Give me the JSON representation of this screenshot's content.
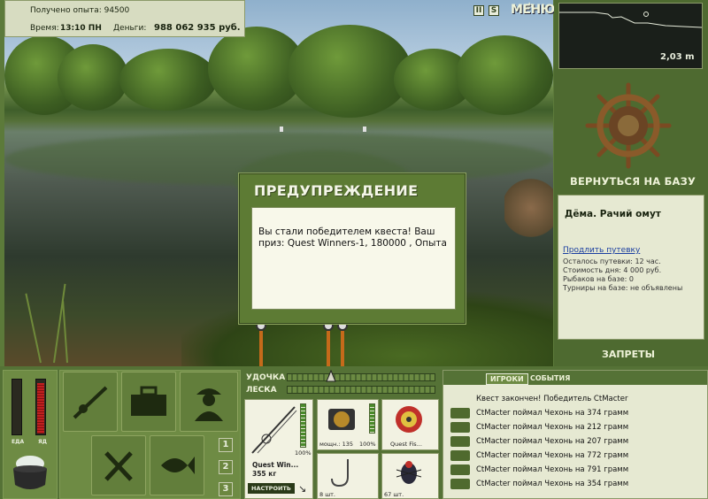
{
  "hud": {
    "exp_label": "Получено опыта: 94500",
    "time_label": "Время:",
    "time_value": "13:10 ПН",
    "money_label": "Деньги:",
    "money_value": "988 062 935 руб."
  },
  "toolbar": {
    "pause_icon": "II",
    "sound_icon": "S",
    "menu_label": "МЕНЮ"
  },
  "depth": {
    "value": "2,03 m"
  },
  "base": {
    "back_label": "ВЕРНУТЬСЯ НА БАЗУ",
    "location": "Дёма. Рачий омут",
    "extend_link": "Продлить путевку",
    "lines": [
      "Осталось путевки: 12 час.",
      "Стоимость дня: 4 000 руб.",
      "Рыбаков на базе: 0",
      "Турниры на базе: не объявлены"
    ],
    "bans_label": "ЗАПРЕТЫ"
  },
  "dialog": {
    "title": "ПРЕДУПРЕЖДЕНИЕ",
    "message": "Вы стали победителем квеста! Ваш приз: Quest Winners-1, 180000 , Опыта"
  },
  "status": {
    "food_label": "ЕДА",
    "poison_label": "ЯД",
    "food_level": 0.0,
    "poison_level": 0.92
  },
  "pages": [
    "1",
    "2",
    "3"
  ],
  "tackle": {
    "rod_label": "УДОЧКА",
    "line_label": "ЛЕСКА",
    "rod_name": "Quest Win...",
    "rod_weight": "355 кг",
    "rod_percent": "100%",
    "setup_button": "НАСТРОИТЬ",
    "reel_power": "мощн.: 135",
    "reel_percent": "100%",
    "line_name": "Quest Fis...",
    "hooks_count": "8 шт.",
    "bait_count": "67 шт."
  },
  "log": {
    "tab_players": "ИГРОКИ",
    "tab_events": "СОБЫТИЯ",
    "header": "Квест закончен! Победитель CtMacter",
    "entries": [
      "CtMacter поймал Чехонь на 374 грамм",
      "CtMacter поймал Чехонь на 212 грамм",
      "CtMacter поймал Чехонь на 207 грамм",
      "CtMacter поймал Чехонь на 772 грамм",
      "CtMacter поймал Чехонь на 791 грамм",
      "CtMacter поймал Чехонь на 354 грамм"
    ]
  }
}
